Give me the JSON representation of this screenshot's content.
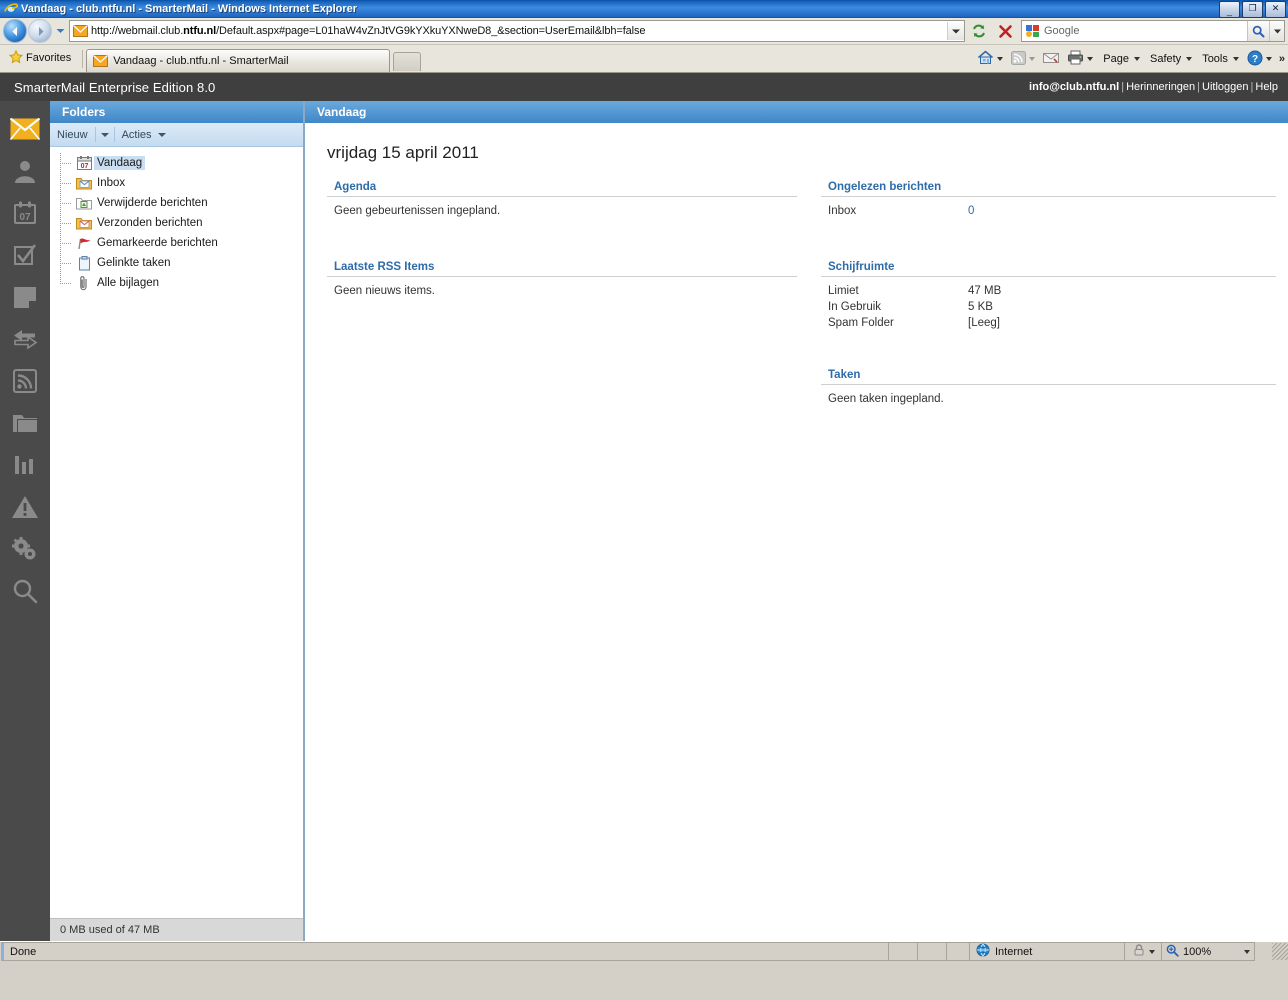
{
  "browser": {
    "window_title": "Vandaag - club.ntfu.nl - SmarterMail - Windows Internet Explorer",
    "window_controls": {
      "minimize": "_",
      "restore": "❐",
      "close": "✕"
    },
    "address": {
      "url_prefix": "http://webmail.club.",
      "url_domain": "ntfu.nl",
      "url_suffix": "/Default.aspx#page=L01haW4vZnJtVG9kYXkuYXNweD8_&section=UserEmail&lbh=false",
      "url_full": "http://webmail.club.ntfu.nl/Default.aspx#page=L01haW4vZnJtVG9kYXkuYXNweD8_&section=UserEmail&lbh=false"
    },
    "search": {
      "placeholder": "Google",
      "provider": "google"
    },
    "favorites_label": "Favorites",
    "tabs": [
      {
        "label": "Vandaag - club.ntfu.nl - SmarterMail",
        "active": true
      }
    ],
    "new_tab_label": "",
    "command_bar": [
      {
        "name": "home",
        "label": ""
      },
      {
        "name": "feeds",
        "label": ""
      },
      {
        "name": "read-mail",
        "label": ""
      },
      {
        "name": "print",
        "label": ""
      },
      {
        "name": "page",
        "label": "Page"
      },
      {
        "name": "safety",
        "label": "Safety"
      },
      {
        "name": "tools",
        "label": "Tools"
      },
      {
        "name": "help",
        "label": ""
      },
      {
        "name": "overflow",
        "label": "»"
      }
    ],
    "status": {
      "text": "Done",
      "zone": "Internet",
      "zoom": "100%"
    }
  },
  "app": {
    "brand": "SmarterMail Enterprise Edition 8.0",
    "account": {
      "email": "info@club.ntfu.nl",
      "links": [
        "Herinneringen",
        "Uitloggen",
        "Help"
      ],
      "separator": "|"
    },
    "rail": [
      {
        "name": "email",
        "icon": "envelope-icon",
        "active": true
      },
      {
        "name": "contacts",
        "icon": "person-icon",
        "active": false
      },
      {
        "name": "calendar",
        "icon": "calendar-icon",
        "active": false,
        "day": "07"
      },
      {
        "name": "tasks",
        "icon": "checkbox-icon",
        "active": false
      },
      {
        "name": "notes",
        "icon": "note-icon",
        "active": false
      },
      {
        "name": "import-export",
        "icon": "arrows-icon",
        "active": false
      },
      {
        "name": "rss-feeds",
        "icon": "rss-icon",
        "active": false
      },
      {
        "name": "file-storage",
        "icon": "folder-icon",
        "active": false
      },
      {
        "name": "reports",
        "icon": "bar-chart-icon",
        "active": false
      },
      {
        "name": "alerts",
        "icon": "warning-icon",
        "active": false
      },
      {
        "name": "settings",
        "icon": "gears-icon",
        "active": false
      },
      {
        "name": "search",
        "icon": "magnifier-icon",
        "active": false
      }
    ],
    "folders_pane": {
      "title": "Folders",
      "toolbar": {
        "new_label": "Nieuw",
        "actions_label": "Acties"
      },
      "tree": [
        {
          "label": "Vandaag",
          "icon": "calendar-day-icon",
          "selected": true
        },
        {
          "label": "Inbox",
          "icon": "inbox-folder-icon",
          "selected": false
        },
        {
          "label": "Verwijderde berichten",
          "icon": "trash-folder-icon",
          "selected": false
        },
        {
          "label": "Verzonden berichten",
          "icon": "sent-folder-icon",
          "selected": false
        },
        {
          "label": "Gemarkeerde berichten",
          "icon": "red-flag-icon",
          "selected": false
        },
        {
          "label": "Gelinkte taken",
          "icon": "clipboard-icon",
          "selected": false
        },
        {
          "label": "Alle bijlagen",
          "icon": "paperclip-icon",
          "selected": false
        }
      ],
      "footer": "0 MB used of 47 MB"
    },
    "content": {
      "title": "Vandaag",
      "date": "vrijdag 15 april 2011",
      "left_sections": [
        {
          "heading": "Agenda",
          "empty_text": "Geen gebeurtenissen ingepland."
        },
        {
          "heading": "Laatste RSS Items",
          "empty_text": "Geen nieuws items."
        }
      ],
      "unread": {
        "heading": "Ongelezen berichten",
        "rows": [
          {
            "label": "Inbox",
            "value": "0"
          }
        ]
      },
      "disk": {
        "heading": "Schijfruimte",
        "rows": [
          {
            "label": "Limiet",
            "value": "47 MB"
          },
          {
            "label": "In Gebruik",
            "value": "5 KB"
          },
          {
            "label": "Spam Folder",
            "value": "[Leeg]"
          }
        ]
      },
      "tasks": {
        "heading": "Taken",
        "empty_text": "Geen taken ingepland."
      }
    }
  },
  "colors": {
    "app_header_bg": "#3f3f3f",
    "rail_bg": "#4a4a4a",
    "pane_header_blue": "#3f87c8",
    "section_heading": "#2d6ca8",
    "active_icon": "#f2b01e"
  }
}
